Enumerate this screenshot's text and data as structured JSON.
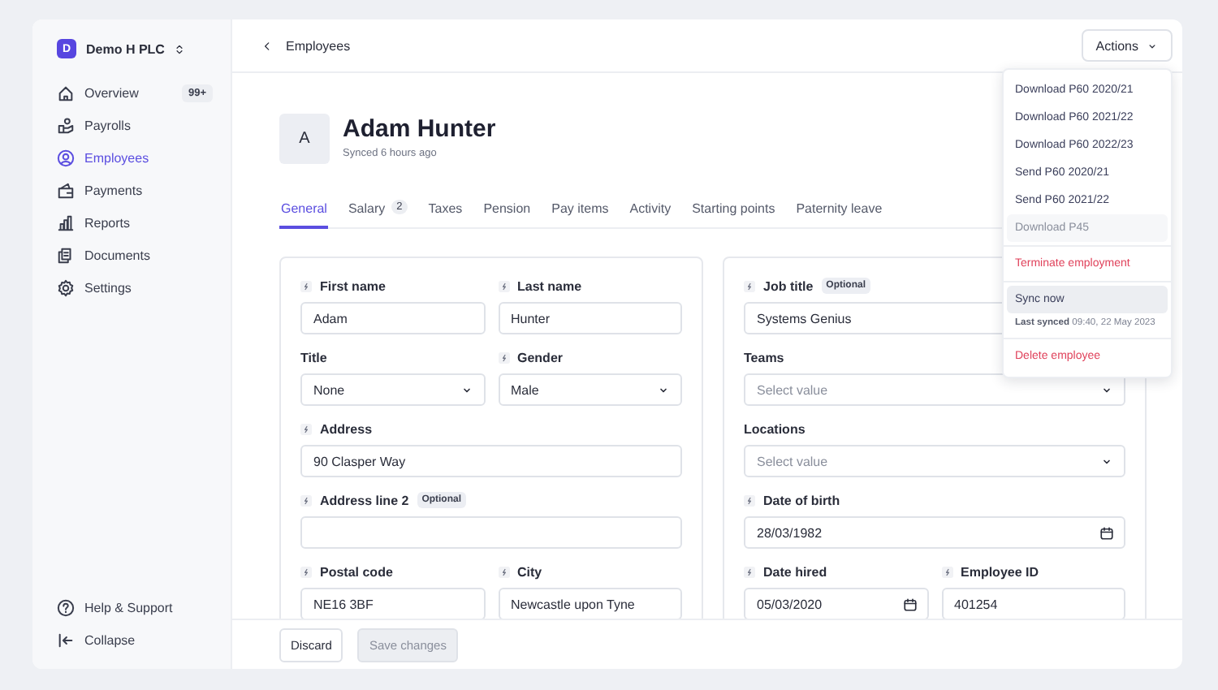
{
  "sidebar": {
    "company": {
      "initial": "D",
      "name": "Demo H PLC"
    },
    "items": [
      {
        "label": "Overview",
        "badge": "99+",
        "selected": false
      },
      {
        "label": "Payrolls",
        "selected": false
      },
      {
        "label": "Employees",
        "selected": true
      },
      {
        "label": "Payments",
        "selected": false
      },
      {
        "label": "Reports",
        "selected": false
      },
      {
        "label": "Documents",
        "selected": false
      },
      {
        "label": "Settings",
        "selected": false
      }
    ],
    "footer_items": [
      {
        "label": "Help & Support"
      },
      {
        "label": "Collapse"
      }
    ]
  },
  "header": {
    "back_label": "Employees",
    "actions_button": "Actions"
  },
  "profile": {
    "initial": "A",
    "name": "Adam Hunter",
    "sync_status": "Synced 6 hours ago"
  },
  "tabs": [
    {
      "label": "General",
      "selected": true
    },
    {
      "label": "Salary",
      "badge": "2",
      "selected": false
    },
    {
      "label": "Taxes",
      "selected": false
    },
    {
      "label": "Pension",
      "selected": false
    },
    {
      "label": "Pay items",
      "selected": false
    },
    {
      "label": "Activity",
      "selected": false
    },
    {
      "label": "Starting points",
      "selected": false
    },
    {
      "label": "Paternity leave",
      "selected": false
    }
  ],
  "cards": [
    {
      "rows": [
        [
          {
            "label": "First name",
            "synced": true,
            "kind": "text",
            "value": "Adam"
          },
          {
            "label": "Last name",
            "synced": true,
            "kind": "text",
            "value": "Hunter"
          }
        ],
        [
          {
            "label": "Title",
            "synced": false,
            "kind": "select",
            "value": "None"
          },
          {
            "label": "Gender",
            "synced": true,
            "kind": "select",
            "value": "Male"
          }
        ],
        [
          {
            "label": "Address",
            "synced": true,
            "kind": "text",
            "value": "90 Clasper Way"
          }
        ],
        [
          {
            "label": "Address line 2",
            "synced": true,
            "optional": "Optional",
            "kind": "text"
          }
        ],
        [
          {
            "label": "Postal code",
            "synced": true,
            "kind": "text",
            "value": "NE16 3BF"
          },
          {
            "label": "City",
            "synced": true,
            "kind": "text",
            "value": "Newcastle upon Tyne"
          }
        ]
      ]
    },
    {
      "rows": [
        [
          {
            "label": "Job title",
            "synced": true,
            "optional": "Optional",
            "kind": "text",
            "value": "Systems Genius"
          }
        ],
        [
          {
            "label": "Teams",
            "synced": false,
            "kind": "select",
            "placeholder": "Select value"
          }
        ],
        [
          {
            "label": "Locations",
            "synced": false,
            "kind": "select",
            "placeholder": "Select value"
          }
        ],
        [
          {
            "label": "Date of birth",
            "synced": true,
            "kind": "date",
            "value": "28/03/1982"
          }
        ],
        [
          {
            "label": "Date hired",
            "synced": true,
            "kind": "date",
            "value": "05/03/2020"
          },
          {
            "label": "Employee ID",
            "synced": true,
            "kind": "text",
            "value": "401254"
          }
        ]
      ]
    }
  ],
  "footer": {
    "discard": "Discard",
    "save": {
      "label": "Save changes",
      "disabled": true
    }
  },
  "actions_menu": {
    "sections": [
      {
        "items": [
          {
            "kind": "action",
            "label": "Download P60 2020/21",
            "disabled": false,
            "hovered": false
          },
          {
            "kind": "action",
            "label": "Download P60 2021/22",
            "disabled": false,
            "hovered": false
          },
          {
            "kind": "action",
            "label": "Download P60 2022/23",
            "disabled": false,
            "hovered": false
          },
          {
            "kind": "action",
            "label": "Send P60 2020/21",
            "disabled": false,
            "hovered": false
          },
          {
            "kind": "action",
            "label": "Send P60 2021/22",
            "disabled": false,
            "hovered": false
          },
          {
            "kind": "action",
            "label": "Download P45",
            "disabled": true,
            "hovered": false
          }
        ]
      },
      {
        "items": [
          {
            "kind": "danger",
            "label": "Terminate employment",
            "disabled": false,
            "hovered": false
          }
        ]
      },
      {
        "items": [
          {
            "kind": "action",
            "label": "Sync now",
            "disabled": false,
            "hovered": true
          },
          {
            "kind": "note",
            "label": "Last synced",
            "value": "09:40, 22 May 2023"
          }
        ]
      },
      {
        "items": [
          {
            "kind": "danger",
            "label": "Delete employee",
            "disabled": false,
            "hovered": false
          }
        ]
      }
    ]
  }
}
